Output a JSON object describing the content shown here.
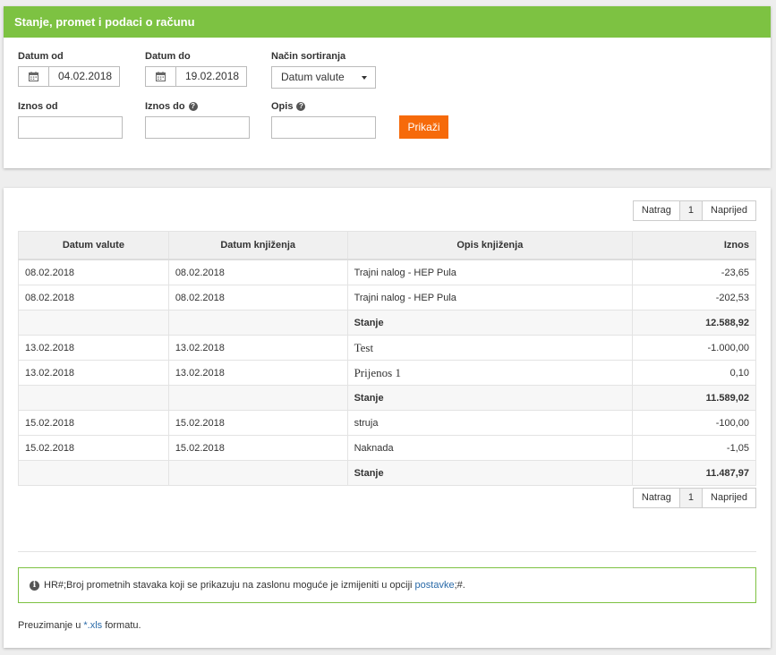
{
  "header": {
    "title": "Stanje, promet i podaci o računu"
  },
  "filters": {
    "date_from": {
      "label": "Datum od",
      "value": "04.02.2018"
    },
    "date_to": {
      "label": "Datum do",
      "value": "19.02.2018"
    },
    "sort": {
      "label": "Način sortiranja",
      "value": "Datum valute"
    },
    "amount_from": {
      "label": "Iznos od",
      "value": ""
    },
    "amount_to": {
      "label": "Iznos do",
      "value": ""
    },
    "description": {
      "label": "Opis",
      "value": ""
    },
    "show_button": "Prikaži"
  },
  "pager": {
    "prev": "Natrag",
    "page": "1",
    "next": "Naprijed"
  },
  "table": {
    "columns": [
      "Datum valute",
      "Datum knjiženja",
      "Opis knjiženja",
      "Iznos"
    ],
    "rows": [
      {
        "valuta": "08.02.2018",
        "knjizenje": "08.02.2018",
        "opis": "Trajni nalog - HEP Pula",
        "iznos": "-23,65"
      },
      {
        "valuta": "08.02.2018",
        "knjizenje": "08.02.2018",
        "opis": "Trajni nalog - HEP Pula",
        "iznos": "-202,53"
      },
      {
        "valuta": "",
        "knjizenje": "",
        "opis": "Stanje",
        "iznos": "12.588,92"
      },
      {
        "valuta": "13.02.2018",
        "knjizenje": "13.02.2018",
        "opis": "Test",
        "iznos": "-1.000,00"
      },
      {
        "valuta": "13.02.2018",
        "knjizenje": "13.02.2018",
        "opis": "Prijenos 1",
        "iznos": "0,10"
      },
      {
        "valuta": "",
        "knjizenje": "",
        "opis": "Stanje",
        "iznos": "11.589,02"
      },
      {
        "valuta": "15.02.2018",
        "knjizenje": "15.02.2018",
        "opis": "struja",
        "iznos": "-100,00"
      },
      {
        "valuta": "15.02.2018",
        "knjizenje": "15.02.2018",
        "opis": "Naknada",
        "iznos": "-1,05"
      },
      {
        "valuta": "",
        "knjizenje": "",
        "opis": "Stanje",
        "iznos": "11.487,97"
      }
    ]
  },
  "info": {
    "text_before": "HR#;Broj prometnih stavaka koji se prikazuju na zaslonu moguće je izmijeniti u opciji ",
    "link": "postavke",
    "text_after": ";#."
  },
  "download": {
    "prefix": "Preuzimanje u ",
    "link": "*.xls",
    "suffix": " formatu."
  }
}
